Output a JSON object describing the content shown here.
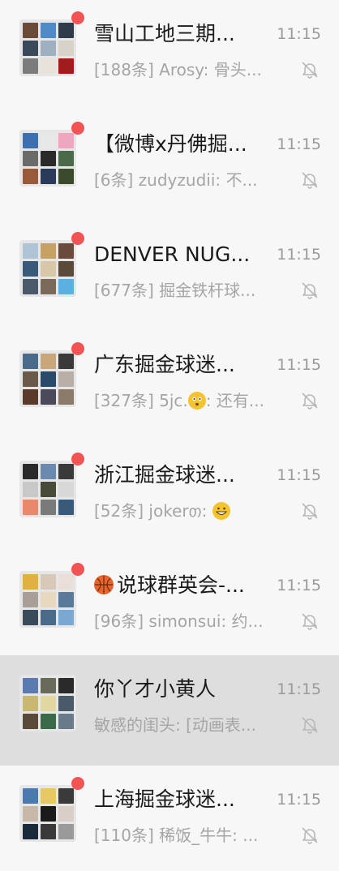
{
  "chats": [
    {
      "name": "雪山工地三期...",
      "time": "11:15",
      "preview": "[188条] Arosy: 骨头...",
      "unread": true,
      "selected": false,
      "avatar_colors": [
        "#6b4a3a",
        "#4f8bc9",
        "#2f3b4a",
        "#3a4a5a",
        "#9fb0c0",
        "#d9d2c8",
        "#7c7c7c",
        "#e8e2da",
        "#a11d1d"
      ]
    },
    {
      "name": "【微博x丹佛掘...",
      "time": "11:15",
      "preview": "[6条] zudyzudii: 不...",
      "unread": true,
      "selected": false,
      "avatar_colors": [
        "#3b6fb0",
        "#e8e8e8",
        "#f0a6c0",
        "#6a6a6a",
        "#2a2a2a",
        "#4a6a4a",
        "#9a5a3a",
        "#2a3a5a",
        "#3a4a2a"
      ]
    },
    {
      "name": "DENVER NUG...",
      "time": "11:15",
      "preview": "[677条] 掘金铁杆球...",
      "unread": true,
      "selected": false,
      "avatar_colors": [
        "#b0c4d8",
        "#c7a064",
        "#6a4a3a",
        "#3a5a7a",
        "#d8c8a8",
        "#5a4a3a",
        "#4a5a6a",
        "#7a6a5a",
        "#5ab0e0"
      ]
    },
    {
      "name": "广东掘金球迷...",
      "time": "11:15",
      "preview": "[327条] 5jc. : 还有...",
      "preview_emoji": "astonished",
      "unread": true,
      "selected": false,
      "avatar_colors": [
        "#4a6a8a",
        "#c8a87a",
        "#3a3a3a",
        "#6a5a4a",
        "#2a4a6a",
        "#b8b0a8",
        "#5a3a2a",
        "#4a4a5a",
        "#8a7a6a"
      ]
    },
    {
      "name": "浙江掘金球迷...",
      "time": "11:15",
      "preview": "[52条] jokerთ: ",
      "preview_emoji": "grinning",
      "unread": true,
      "selected": false,
      "avatar_colors": [
        "#2a2a2a",
        "#6a8ab0",
        "#3a3a3a",
        "#c8c8c8",
        "#4a4a3a",
        "#d8d8d8",
        "#e88a6a",
        "#7a7a7a",
        "#3a5a7a"
      ]
    },
    {
      "name": "说球群英会-...",
      "name_icon": "basketball",
      "time": "11:15",
      "preview": "[96条] simonsui: 约...",
      "unread": true,
      "selected": false,
      "avatar_colors": [
        "#e0b040",
        "#d8c8b8",
        "#e8e0d8",
        "#a8a098",
        "#e8d8c0",
        "#5a7a9a",
        "#3a4a5a",
        "#4a6a8a",
        "#7aa8d0"
      ]
    },
    {
      "name": "你丫才小黄人",
      "time": "11:15",
      "preview": "敏感的闺头: [动画表...",
      "unread": false,
      "selected": true,
      "avatar_colors": [
        "#5a7ab0",
        "#6a6a5a",
        "#2a2a2a",
        "#c8b870",
        "#e0d8a0",
        "#4a5a6a",
        "#5a4a3a",
        "#3a6a4a",
        "#6a7a8a"
      ]
    },
    {
      "name": "上海掘金球迷...",
      "time": "11:15",
      "preview": "[110条] 稀饭_牛牛: ...",
      "unread": true,
      "selected": false,
      "avatar_colors": [
        "#4a7ab0",
        "#e8c860",
        "#3a3a3a",
        "#c8b8a8",
        "#1a1a1a",
        "#d8d0c8",
        "#1a2a3a",
        "#3a3a3a",
        "#9a9a9a"
      ]
    }
  ]
}
